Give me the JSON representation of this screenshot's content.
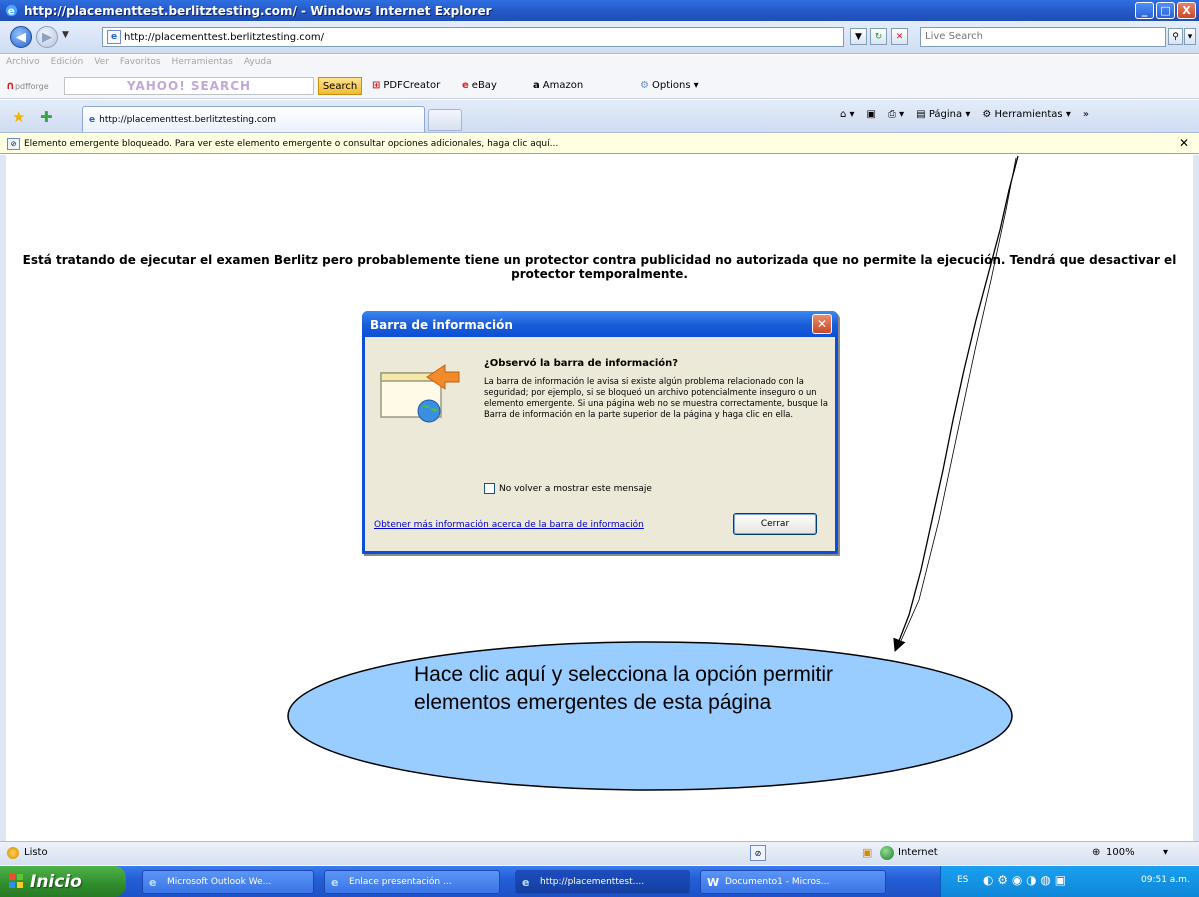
{
  "window": {
    "title": "http://placementtest.berlitztesting.com/ - Windows Internet Explorer",
    "minimize": "_",
    "maximize": "□",
    "close": "X"
  },
  "addressbar": {
    "url": "http://placementtest.berlitztesting.com/",
    "search_placeholder": "Live Search"
  },
  "menubar": {
    "items": [
      "Archivo",
      "Edición",
      "Ver",
      "Favoritos",
      "Herramientas",
      "Ayuda"
    ]
  },
  "toolbar": {
    "pdfforge": "pdfforge",
    "yahoo_logo": "YAHOO! SEARCH",
    "search_btn": "Search",
    "pdfcreator": "PDFCreator",
    "ebay": "eBay",
    "amazon": "Amazon",
    "options": "Options"
  },
  "tabs": {
    "active_tab": "http://placementtest.berlitztesting.com"
  },
  "commandbar": {
    "pagina": "Página",
    "herramientas": "Herramientas"
  },
  "infobar": {
    "message": "Elemento emergente bloqueado. Para ver este elemento emergente o consultar opciones adicionales, haga clic aquí..."
  },
  "content": {
    "message": "Está tratando de ejecutar el examen Berlitz pero probablemente tiene un protector contra publicidad no autorizada que no permite la ejecución. Tendrá que desactivar el protector temporalmente."
  },
  "dialog": {
    "title": "Barra de información",
    "heading": "¿Observó la barra de información?",
    "body": "La barra de información le avisa si existe algún problema relacionado con la seguridad; por ejemplo, si se bloqueó un archivo potencialmente inseguro o un elemento emergente. Si una página web no se muestra correctamente, busque la Barra de información en la parte superior de la página y haga clic en ella.",
    "checkbox": "No volver a mostrar este mensaje",
    "link": "Obtener más información acerca de la barra de información",
    "close_btn": "Cerrar"
  },
  "annotation": {
    "text": "Hace clic aquí y selecciona la opción permitir elementos emergentes de esta página"
  },
  "statusbar": {
    "status": "Listo",
    "zone": "Internet",
    "zoom": "100%"
  },
  "taskbar": {
    "start": "Inicio",
    "tasks": [
      {
        "label": "Microsoft Outlook We..."
      },
      {
        "label": "Enlace presentación ..."
      },
      {
        "label": "http://placementtest...."
      },
      {
        "label": "Documento1 - Micros..."
      }
    ],
    "lang": "ES",
    "clock": "09:51 a.m."
  }
}
